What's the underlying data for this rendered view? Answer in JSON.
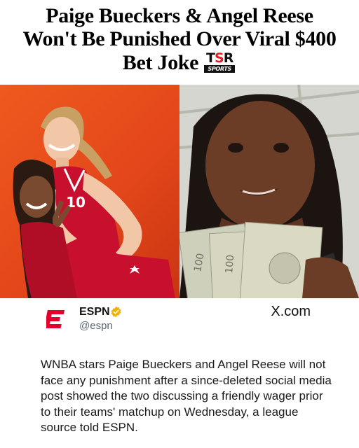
{
  "headline": {
    "line1": "Paige Bueckers & Angel Reese",
    "line2": "Won't Be Punished Over Viral $400",
    "line3": "Bet Joke"
  },
  "brand_logo": {
    "mark": "TSR",
    "subtitle": "SPORTS",
    "accent_color": "#e31b23"
  },
  "photos": {
    "left_background": "#e4471a",
    "jersey_color": "#c8102e",
    "jersey_number_text": "10"
  },
  "tweet": {
    "account_name": "ESPN",
    "handle": "@espn",
    "verified_color": "#f0b400",
    "logo_color": "#e4002b",
    "source": "X.com",
    "text": "WNBA stars Paige Bueckers and Angel Reese will not face any punishment after a since-deleted social media post showed the two discussing a friendly wager prior to their teams' matchup on Wednesday, a league source told ESPN."
  }
}
